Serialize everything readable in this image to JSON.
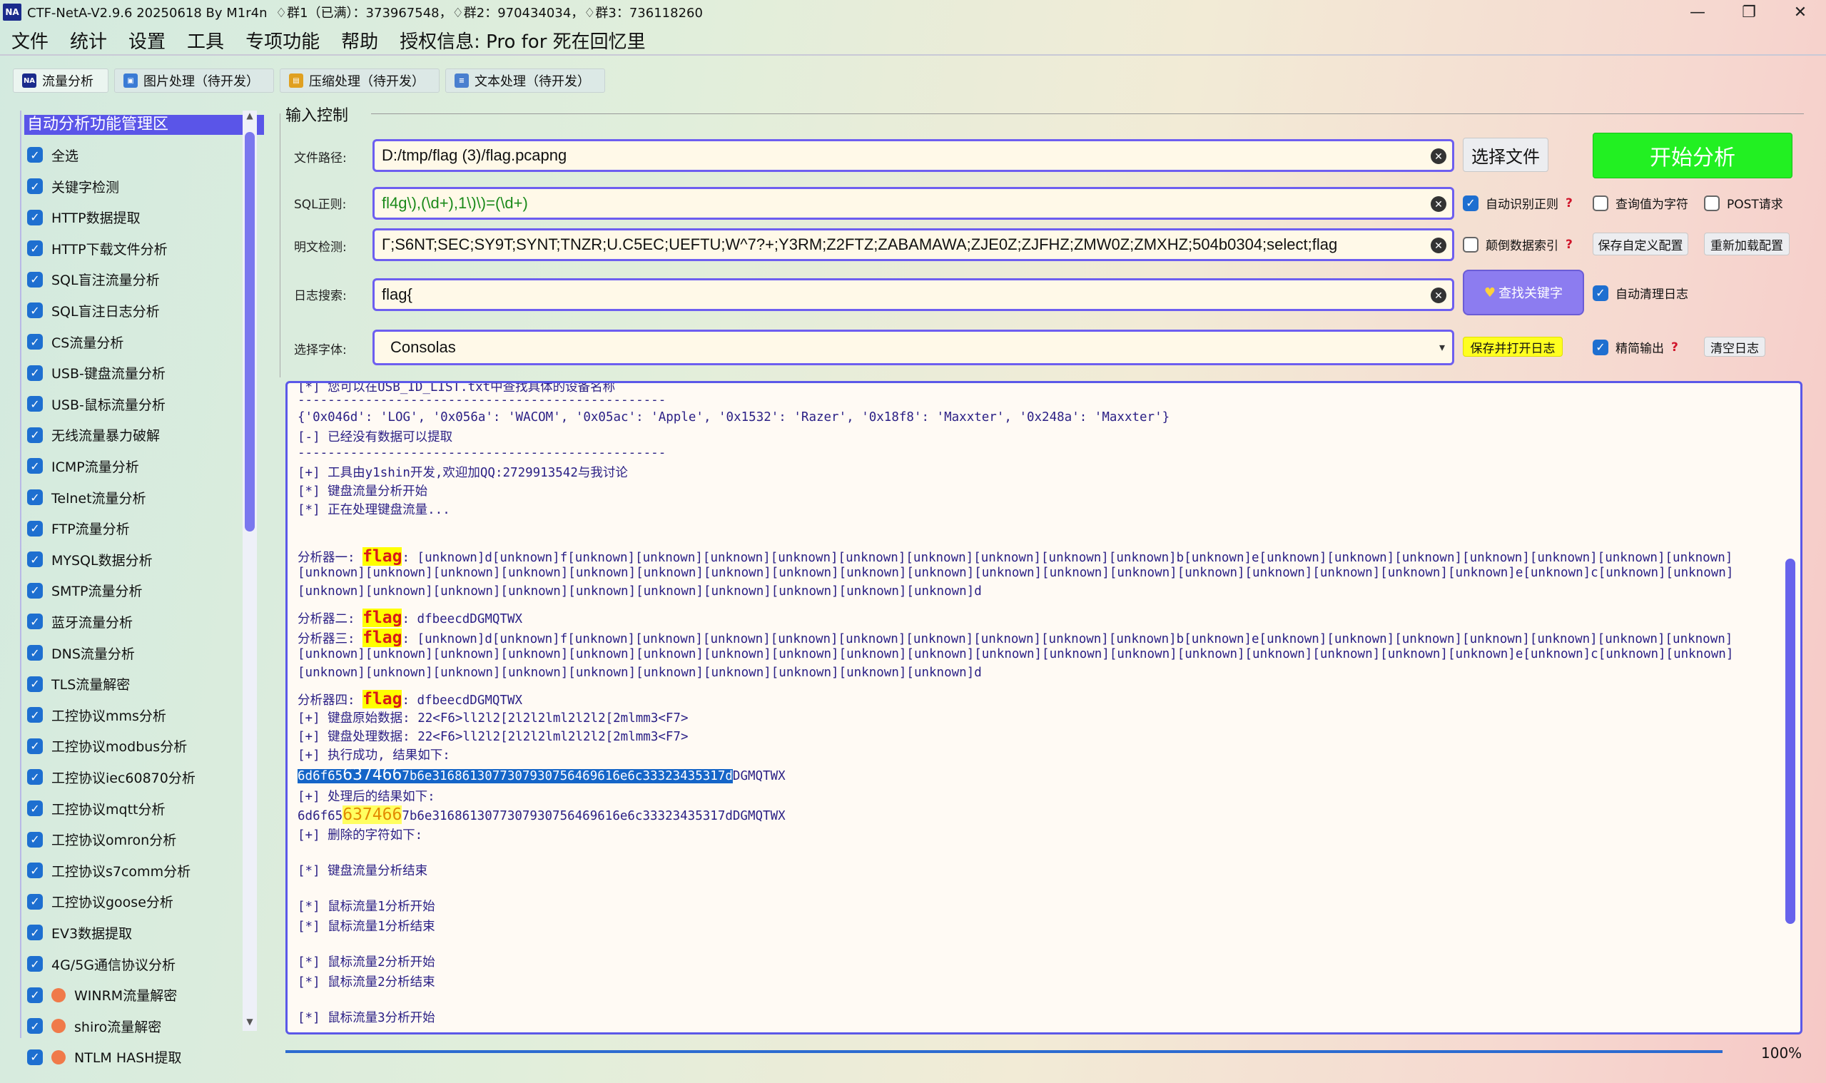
{
  "window": {
    "logo_text": "NA",
    "title": "CTF-NetA-V2.9.6 20250618 By M1r4n  ♢群1（已满）：373967548，♢群2：970434034，♢群3：736118260",
    "minimize": "—",
    "maximize": "❐",
    "close": "✕"
  },
  "menu": [
    "文件",
    "统计",
    "设置",
    "工具",
    "专项功能",
    "帮助",
    "授权信息: Pro for 死在回忆里"
  ],
  "tabs": [
    {
      "label": "流量分析",
      "icon": "na-logo-icon",
      "color": "#1a2b8c"
    },
    {
      "label": "图片处理（待开发）",
      "icon": "image-icon",
      "color": "#3a7bd5"
    },
    {
      "label": "压缩处理（待开发）",
      "icon": "archive-icon",
      "color": "#e0a020"
    },
    {
      "label": "文本处理（待开发）",
      "icon": "document-icon",
      "color": "#4a7fcf"
    }
  ],
  "left_panel": {
    "title": "自动分析功能管理区",
    "select_all": "全选",
    "items": [
      {
        "label": "关键字检测",
        "state": "checked"
      },
      {
        "label": "HTTP数据提取",
        "state": "checked"
      },
      {
        "label": "HTTP下载文件分析",
        "state": "checked"
      },
      {
        "label": "SQL盲注流量分析",
        "state": "checked"
      },
      {
        "label": "SQL盲注日志分析",
        "state": "checked"
      },
      {
        "label": "CS流量分析",
        "state": "checked"
      },
      {
        "label": "USB-键盘流量分析",
        "state": "checked"
      },
      {
        "label": "USB-鼠标流量分析",
        "state": "checked"
      },
      {
        "label": "无线流量暴力破解",
        "state": "checked"
      },
      {
        "label": "ICMP流量分析",
        "state": "checked"
      },
      {
        "label": "Telnet流量分析",
        "state": "checked"
      },
      {
        "label": "FTP流量分析",
        "state": "checked"
      },
      {
        "label": "MYSQL数据分析",
        "state": "checked"
      },
      {
        "label": "SMTP流量分析",
        "state": "checked"
      },
      {
        "label": "蓝牙流量分析",
        "state": "checked"
      },
      {
        "label": "DNS流量分析",
        "state": "checked"
      },
      {
        "label": "TLS流量解密",
        "state": "checked"
      },
      {
        "label": "工控协议mms分析",
        "state": "checked"
      },
      {
        "label": "工控协议modbus分析",
        "state": "checked"
      },
      {
        "label": "工控协议iec60870分析",
        "state": "checked"
      },
      {
        "label": "工控协议mqtt分析",
        "state": "checked"
      },
      {
        "label": "工控协议omron分析",
        "state": "checked"
      },
      {
        "label": "工控协议s7comm分析",
        "state": "checked"
      },
      {
        "label": "工控协议goose分析",
        "state": "checked"
      },
      {
        "label": "EV3数据提取",
        "state": "checked"
      },
      {
        "label": "4G/5G通信协议分析",
        "state": "checked"
      },
      {
        "label": "WINRM流量解密",
        "state": "checked-warn"
      },
      {
        "label": "shiro流量解密",
        "state": "checked-warn"
      },
      {
        "label": "NTLM HASH提取",
        "state": "checked-warn"
      }
    ]
  },
  "input_control": {
    "group_title": "输入控制",
    "file_path": {
      "label": "文件路径:",
      "value": "D:/tmp/flag (3)/flag.pcapng"
    },
    "sql_regex": {
      "label": "SQL正则:",
      "value": "fl4g\\),(\\d+),1\\)\\)=(\\d+)"
    },
    "plaintext": {
      "label": "明文检测:",
      "value": "Γ;S6NT;SEC;SY9T;SYNT;TNZR;U.C5EC;UEFTU;W^7?+;Y3RM;Z2FTZ;ZABAMAWA;ZJE0Z;ZJFHZ;ZMW0Z;ZMXHZ;504b0304;select;flag"
    },
    "log_search": {
      "label": "日志搜索:",
      "value": "flag{"
    },
    "font_select": {
      "label": "选择字体:",
      "value": "Consolas"
    },
    "buttons": {
      "choose_file": "选择文件",
      "start_analysis": "开始分析",
      "find_keyword": "查找关键字",
      "save_custom": "保存自定义配置",
      "reload_config": "重新加载配置",
      "save_open_log": "保存并打开日志",
      "clear_log": "清空日志"
    },
    "options": {
      "auto_regex": {
        "label": "自动识别正则",
        "checked": true
      },
      "query_as_char": {
        "label": "查询值为字符",
        "checked": false
      },
      "post_request": {
        "label": "POST请求",
        "checked": false
      },
      "reverse_index": {
        "label": "颠倒数据索引",
        "checked": false
      },
      "auto_clear_log": {
        "label": "自动清理日志",
        "checked": true
      },
      "concise_output": {
        "label": "精简输出",
        "checked": true
      }
    },
    "help_mark": "?"
  },
  "log": {
    "l00": "[*] 您可以在USB_ID_LIST.txt中查找具体的设备名称",
    "l01": "-------------------------------------------------",
    "l02": "{'0x046d': 'LOG', '0x056a': 'WACOM', '0x05ac': 'Apple', '0x1532': 'Razer', '0x18f8': 'Maxxter', '0x248a': 'Maxxter'}",
    "l03": "[-] 已经没有数据可以提取",
    "l04": "-------------------------------------------------",
    "l05": "[+] 工具由y1shin开发,欢迎加QQ:2729913542与我讨论",
    "l06": "[*] 键盘流量分析开始",
    "l07": "[*] 正在处理键盘流量...",
    "a1_prefix": "分析器一: ",
    "flag_word": "flag",
    "a1_line1": ": [unknown]d[unknown]f[unknown][unknown][unknown][unknown][unknown][unknown][unknown][unknown][unknown]b[unknown]e[unknown][unknown][unknown][unknown][unknown][unknown][unknown]",
    "a1_line2": "[unknown][unknown][unknown][unknown][unknown][unknown][unknown][unknown][unknown][unknown][unknown][unknown][unknown][unknown][unknown][unknown][unknown][unknown]e[unknown]c[unknown][unknown]",
    "a1_line3": "[unknown][unknown][unknown][unknown][unknown][unknown][unknown][unknown][unknown][unknown]d",
    "a2_prefix": "分析器二: ",
    "a2_value": ": dfbeecdDGMQTWX",
    "a3_prefix": "分析器三: ",
    "a4_prefix": "分析器四: ",
    "a4_value": ": dfbeecdDGMQTWX",
    "k1": "[+] 键盘原始数据: 22<F6>ll2l2[2l2l2lml2l2l2[2mlmm3<F7>",
    "k2": "[+] 键盘处理数据: 22<F6>ll2l2[2l2l2lml2l2l2[2mlmm3<F7>",
    "k3": "[+] 执行成功, 结果如下:",
    "res_a": "6d6f65",
    "res_b": "637466",
    "res_c": "7b6e3168613077307930756469616e6c3332343531",
    "res_d": "7d",
    "res_tail": "DGMQTWX",
    "k4": "[+] 处理后的结果如下:",
    "res2_tail": "7b6e3168613077307930756469616e6c33323435317dDGMQTWX",
    "k5": "[+] 删除的字符如下:",
    "k6": "[*] 键盘流量分析结束",
    "m1": "[*] 鼠标流量1分析开始",
    "m2": "[*] 鼠标流量1分析结束",
    "m3": "[*] 鼠标流量2分析开始",
    "m4": "[*] 鼠标流量2分析结束",
    "m5": "[*] 鼠标流量3分析开始"
  },
  "progress": {
    "value": 1.0,
    "label": "100%"
  },
  "colors": {
    "accent": "#5b58e8",
    "start_button": "#22f022",
    "find_button": "#8c7cf0",
    "highlight": "#ffff00"
  }
}
